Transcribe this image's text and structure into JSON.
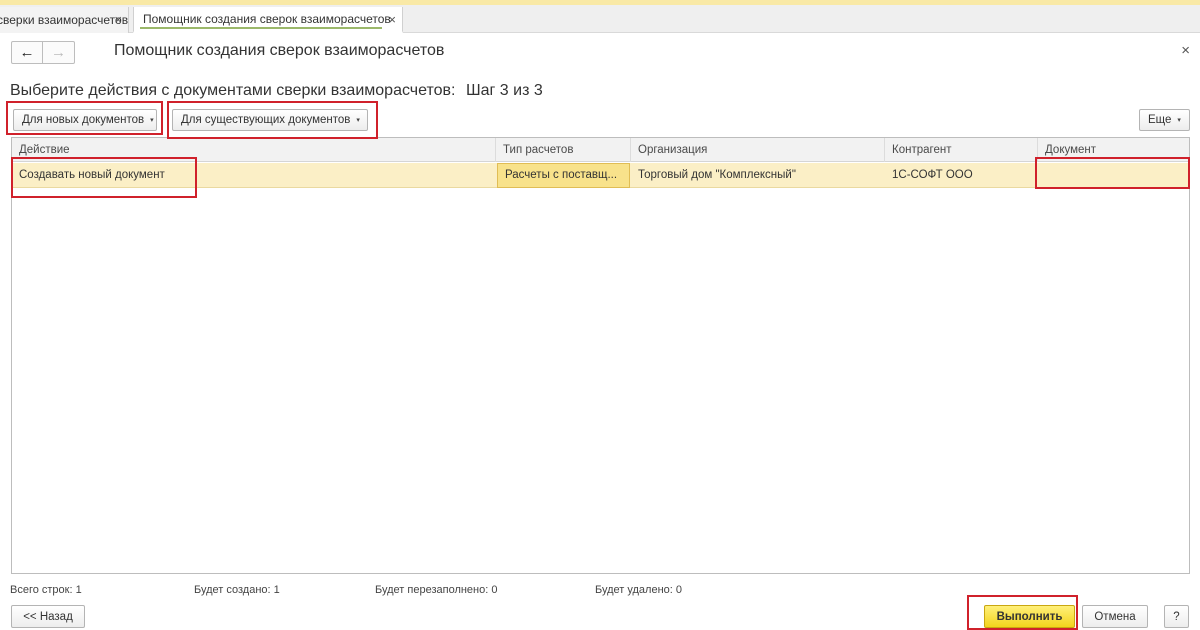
{
  "tabs": [
    {
      "label": "сверки взаиморасчетов"
    },
    {
      "label": "Помощник создания сверок взаиморасчетов"
    }
  ],
  "window": {
    "title": "Помощник создания сверок взаиморасчетов",
    "back_icon": "←",
    "forward_icon": "→",
    "close_icon": "×"
  },
  "step": {
    "prompt": "Выберите действия с документами сверки взаиморасчетов:",
    "counter": "Шаг 3 из 3"
  },
  "toolbar": {
    "new_docs_label": "Для новых документов",
    "existing_docs_label": "Для существующих документов",
    "more_label": "Еще",
    "caret": "▾"
  },
  "table": {
    "columns": [
      "Действие",
      "Тип расчетов",
      "Организация",
      "Контрагент",
      "Документ"
    ],
    "rows": [
      {
        "action": "Создавать новый документ",
        "settlement_type": "Расчеты с поставщ...",
        "organization": "Торговый дом \"Комплексный\"",
        "counterparty": "1С-СОФТ ООО",
        "document": ""
      }
    ]
  },
  "stats": {
    "total": "Всего строк:  1",
    "created": "Будет создано:  1",
    "refilled": "Будет перезаполнено:  0",
    "deleted": "Будет удалено:  0"
  },
  "footer": {
    "back_label": "<< Назад",
    "execute_label": "Выполнить",
    "cancel_label": "Отмена",
    "help_label": "?"
  },
  "colors": {
    "highlight": "#d0212b",
    "row_selected": "#fbefc6",
    "primary_button": "#f3d31c"
  }
}
